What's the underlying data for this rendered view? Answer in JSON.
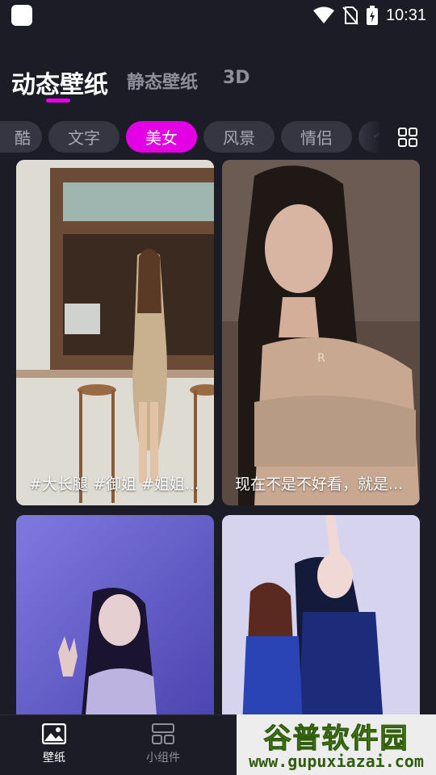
{
  "status_bar": {
    "time": "10:31"
  },
  "top_tabs": [
    {
      "label": "动态壁纸"
    },
    {
      "label": "静态壁纸"
    },
    {
      "label": "3D"
    }
  ],
  "categories": [
    {
      "label": "酷"
    },
    {
      "label": "文字"
    },
    {
      "label": "美女"
    },
    {
      "label": "风景"
    },
    {
      "label": "情侣"
    },
    {
      "label": "个"
    }
  ],
  "selected_category": "美女",
  "wallpapers": [
    {
      "caption": "#大长腿 #御姐 #姐姐..."
    },
    {
      "caption": "现在不是不好看，就是..."
    },
    {
      "caption": ""
    },
    {
      "caption": ""
    }
  ],
  "bottom_nav": [
    {
      "label": "壁纸",
      "icon": "image-icon"
    },
    {
      "label": "小组件",
      "icon": "widgets-icon"
    }
  ],
  "watermark": {
    "title": "谷普软件园",
    "url": "www.gupuxiazai.com"
  },
  "colors": {
    "accent": "#e400e4",
    "background": "#1b1c26",
    "chip": "#353641"
  }
}
